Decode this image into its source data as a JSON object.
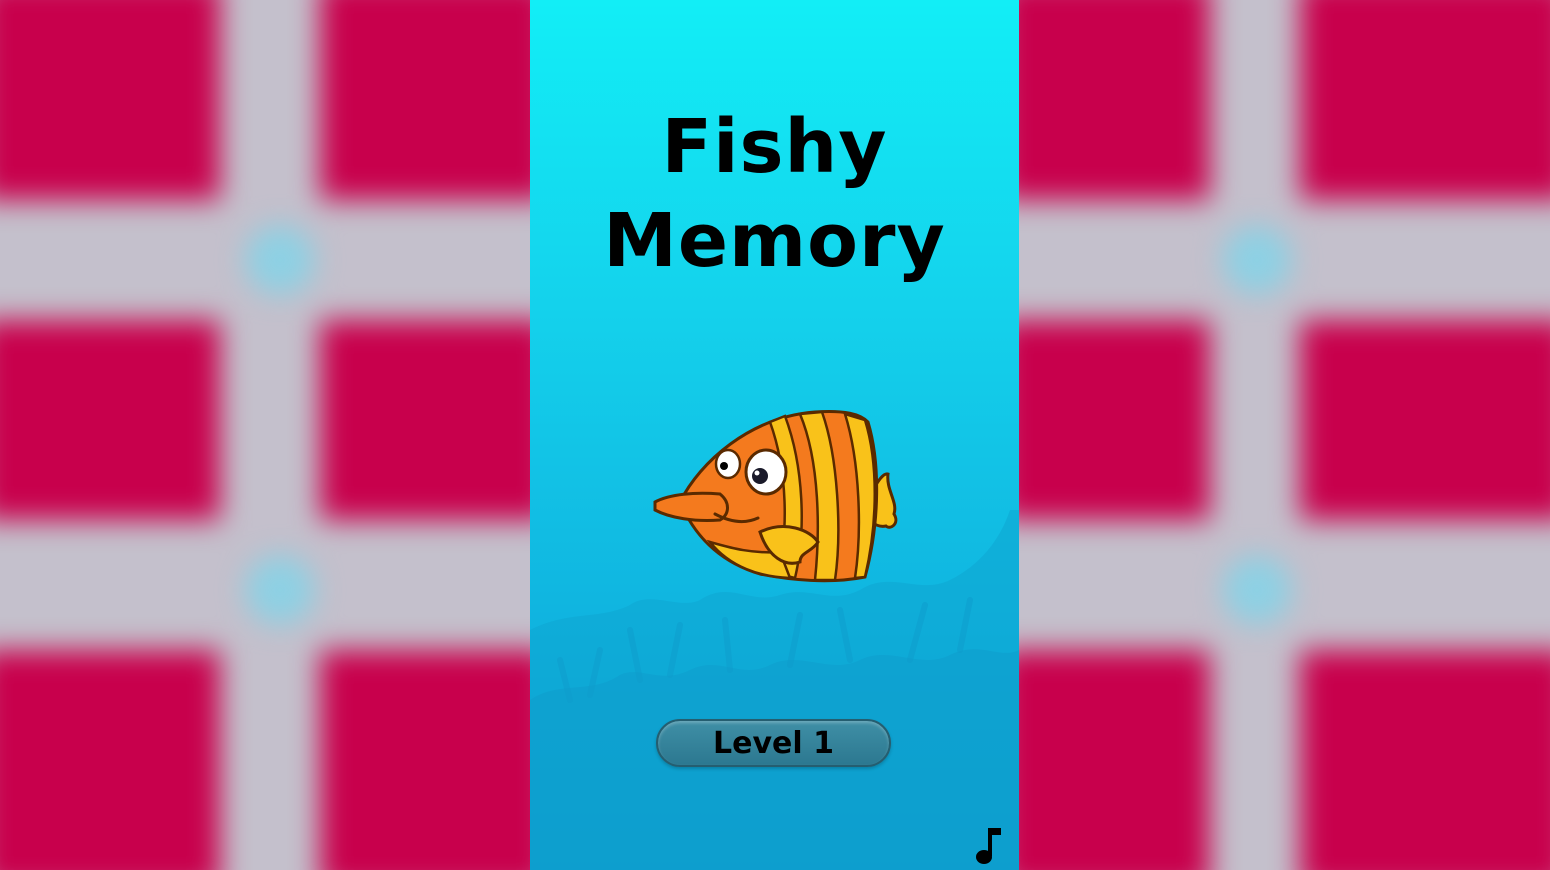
{
  "game": {
    "title_line1": "Fishy",
    "title_line2": "Memory",
    "level_button_label": "Level 1",
    "music_icon": "music-note-icon",
    "mascot_icon": "fish-icon"
  },
  "colors": {
    "background_tile": "#c8004c",
    "background_grid": "#c4c0cc",
    "sea_top": "#12eef6",
    "sea_bottom": "#0b9ccf",
    "fish_orange": "#f47a1e",
    "fish_yellow": "#f9c21a",
    "button": "#3f8fa6"
  }
}
